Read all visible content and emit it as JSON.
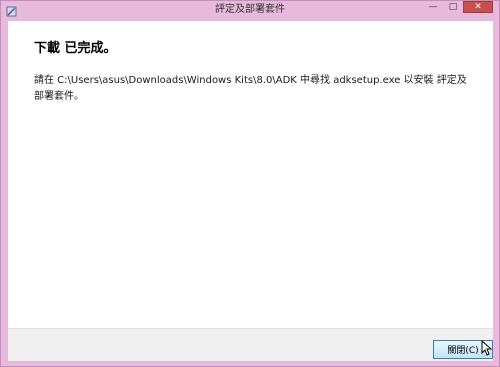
{
  "window": {
    "title": "評定及部署套件"
  },
  "controls": {
    "minimize": "—",
    "maximize": "□",
    "close": "✕"
  },
  "content": {
    "heading": "下載 已完成。",
    "message": "請在 C:\\Users\\asus\\Downloads\\Windows Kits\\8.0\\ADK 中尋找 adksetup.exe 以安裝 評定及部署套件。"
  },
  "footer": {
    "close_label": "關閉(C)"
  },
  "colors": {
    "frame": "#e7b9dc",
    "close_control": "#c7504f",
    "button_border": "#3c7fb1"
  }
}
